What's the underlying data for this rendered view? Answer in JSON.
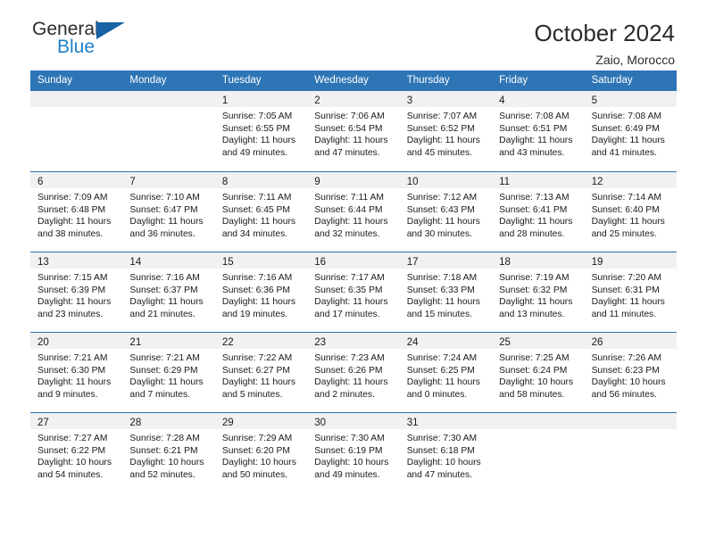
{
  "brand": {
    "line1": "General",
    "line2": "Blue",
    "triangle_icon": "blue-triangle-icon",
    "color_dark": "#2b2b2b",
    "color_blue": "#1f7fc4"
  },
  "header": {
    "title": "October 2024",
    "subtitle": "Zaio, Morocco"
  },
  "theme": {
    "header_blue": "#2e75b6",
    "day_strip_gray": "#f1f1f1",
    "text": "#1a1a1a"
  },
  "calendar": {
    "weekdays": [
      "Sunday",
      "Monday",
      "Tuesday",
      "Wednesday",
      "Thursday",
      "Friday",
      "Saturday"
    ],
    "weeks": [
      [
        {
          "day": "",
          "lines": []
        },
        {
          "day": "",
          "lines": []
        },
        {
          "day": "1",
          "lines": [
            "Sunrise: 7:05 AM",
            "Sunset: 6:55 PM",
            "Daylight: 11 hours",
            "and 49 minutes."
          ]
        },
        {
          "day": "2",
          "lines": [
            "Sunrise: 7:06 AM",
            "Sunset: 6:54 PM",
            "Daylight: 11 hours",
            "and 47 minutes."
          ]
        },
        {
          "day": "3",
          "lines": [
            "Sunrise: 7:07 AM",
            "Sunset: 6:52 PM",
            "Daylight: 11 hours",
            "and 45 minutes."
          ]
        },
        {
          "day": "4",
          "lines": [
            "Sunrise: 7:08 AM",
            "Sunset: 6:51 PM",
            "Daylight: 11 hours",
            "and 43 minutes."
          ]
        },
        {
          "day": "5",
          "lines": [
            "Sunrise: 7:08 AM",
            "Sunset: 6:49 PM",
            "Daylight: 11 hours",
            "and 41 minutes."
          ]
        }
      ],
      [
        {
          "day": "6",
          "lines": [
            "Sunrise: 7:09 AM",
            "Sunset: 6:48 PM",
            "Daylight: 11 hours",
            "and 38 minutes."
          ]
        },
        {
          "day": "7",
          "lines": [
            "Sunrise: 7:10 AM",
            "Sunset: 6:47 PM",
            "Daylight: 11 hours",
            "and 36 minutes."
          ]
        },
        {
          "day": "8",
          "lines": [
            "Sunrise: 7:11 AM",
            "Sunset: 6:45 PM",
            "Daylight: 11 hours",
            "and 34 minutes."
          ]
        },
        {
          "day": "9",
          "lines": [
            "Sunrise: 7:11 AM",
            "Sunset: 6:44 PM",
            "Daylight: 11 hours",
            "and 32 minutes."
          ]
        },
        {
          "day": "10",
          "lines": [
            "Sunrise: 7:12 AM",
            "Sunset: 6:43 PM",
            "Daylight: 11 hours",
            "and 30 minutes."
          ]
        },
        {
          "day": "11",
          "lines": [
            "Sunrise: 7:13 AM",
            "Sunset: 6:41 PM",
            "Daylight: 11 hours",
            "and 28 minutes."
          ]
        },
        {
          "day": "12",
          "lines": [
            "Sunrise: 7:14 AM",
            "Sunset: 6:40 PM",
            "Daylight: 11 hours",
            "and 25 minutes."
          ]
        }
      ],
      [
        {
          "day": "13",
          "lines": [
            "Sunrise: 7:15 AM",
            "Sunset: 6:39 PM",
            "Daylight: 11 hours",
            "and 23 minutes."
          ]
        },
        {
          "day": "14",
          "lines": [
            "Sunrise: 7:16 AM",
            "Sunset: 6:37 PM",
            "Daylight: 11 hours",
            "and 21 minutes."
          ]
        },
        {
          "day": "15",
          "lines": [
            "Sunrise: 7:16 AM",
            "Sunset: 6:36 PM",
            "Daylight: 11 hours",
            "and 19 minutes."
          ]
        },
        {
          "day": "16",
          "lines": [
            "Sunrise: 7:17 AM",
            "Sunset: 6:35 PM",
            "Daylight: 11 hours",
            "and 17 minutes."
          ]
        },
        {
          "day": "17",
          "lines": [
            "Sunrise: 7:18 AM",
            "Sunset: 6:33 PM",
            "Daylight: 11 hours",
            "and 15 minutes."
          ]
        },
        {
          "day": "18",
          "lines": [
            "Sunrise: 7:19 AM",
            "Sunset: 6:32 PM",
            "Daylight: 11 hours",
            "and 13 minutes."
          ]
        },
        {
          "day": "19",
          "lines": [
            "Sunrise: 7:20 AM",
            "Sunset: 6:31 PM",
            "Daylight: 11 hours",
            "and 11 minutes."
          ]
        }
      ],
      [
        {
          "day": "20",
          "lines": [
            "Sunrise: 7:21 AM",
            "Sunset: 6:30 PM",
            "Daylight: 11 hours",
            "and 9 minutes."
          ]
        },
        {
          "day": "21",
          "lines": [
            "Sunrise: 7:21 AM",
            "Sunset: 6:29 PM",
            "Daylight: 11 hours",
            "and 7 minutes."
          ]
        },
        {
          "day": "22",
          "lines": [
            "Sunrise: 7:22 AM",
            "Sunset: 6:27 PM",
            "Daylight: 11 hours",
            "and 5 minutes."
          ]
        },
        {
          "day": "23",
          "lines": [
            "Sunrise: 7:23 AM",
            "Sunset: 6:26 PM",
            "Daylight: 11 hours",
            "and 2 minutes."
          ]
        },
        {
          "day": "24",
          "lines": [
            "Sunrise: 7:24 AM",
            "Sunset: 6:25 PM",
            "Daylight: 11 hours",
            "and 0 minutes."
          ]
        },
        {
          "day": "25",
          "lines": [
            "Sunrise: 7:25 AM",
            "Sunset: 6:24 PM",
            "Daylight: 10 hours",
            "and 58 minutes."
          ]
        },
        {
          "day": "26",
          "lines": [
            "Sunrise: 7:26 AM",
            "Sunset: 6:23 PM",
            "Daylight: 10 hours",
            "and 56 minutes."
          ]
        }
      ],
      [
        {
          "day": "27",
          "lines": [
            "Sunrise: 7:27 AM",
            "Sunset: 6:22 PM",
            "Daylight: 10 hours",
            "and 54 minutes."
          ]
        },
        {
          "day": "28",
          "lines": [
            "Sunrise: 7:28 AM",
            "Sunset: 6:21 PM",
            "Daylight: 10 hours",
            "and 52 minutes."
          ]
        },
        {
          "day": "29",
          "lines": [
            "Sunrise: 7:29 AM",
            "Sunset: 6:20 PM",
            "Daylight: 10 hours",
            "and 50 minutes."
          ]
        },
        {
          "day": "30",
          "lines": [
            "Sunrise: 7:30 AM",
            "Sunset: 6:19 PM",
            "Daylight: 10 hours",
            "and 49 minutes."
          ]
        },
        {
          "day": "31",
          "lines": [
            "Sunrise: 7:30 AM",
            "Sunset: 6:18 PM",
            "Daylight: 10 hours",
            "and 47 minutes."
          ]
        },
        {
          "day": "",
          "lines": []
        },
        {
          "day": "",
          "lines": []
        }
      ]
    ]
  }
}
